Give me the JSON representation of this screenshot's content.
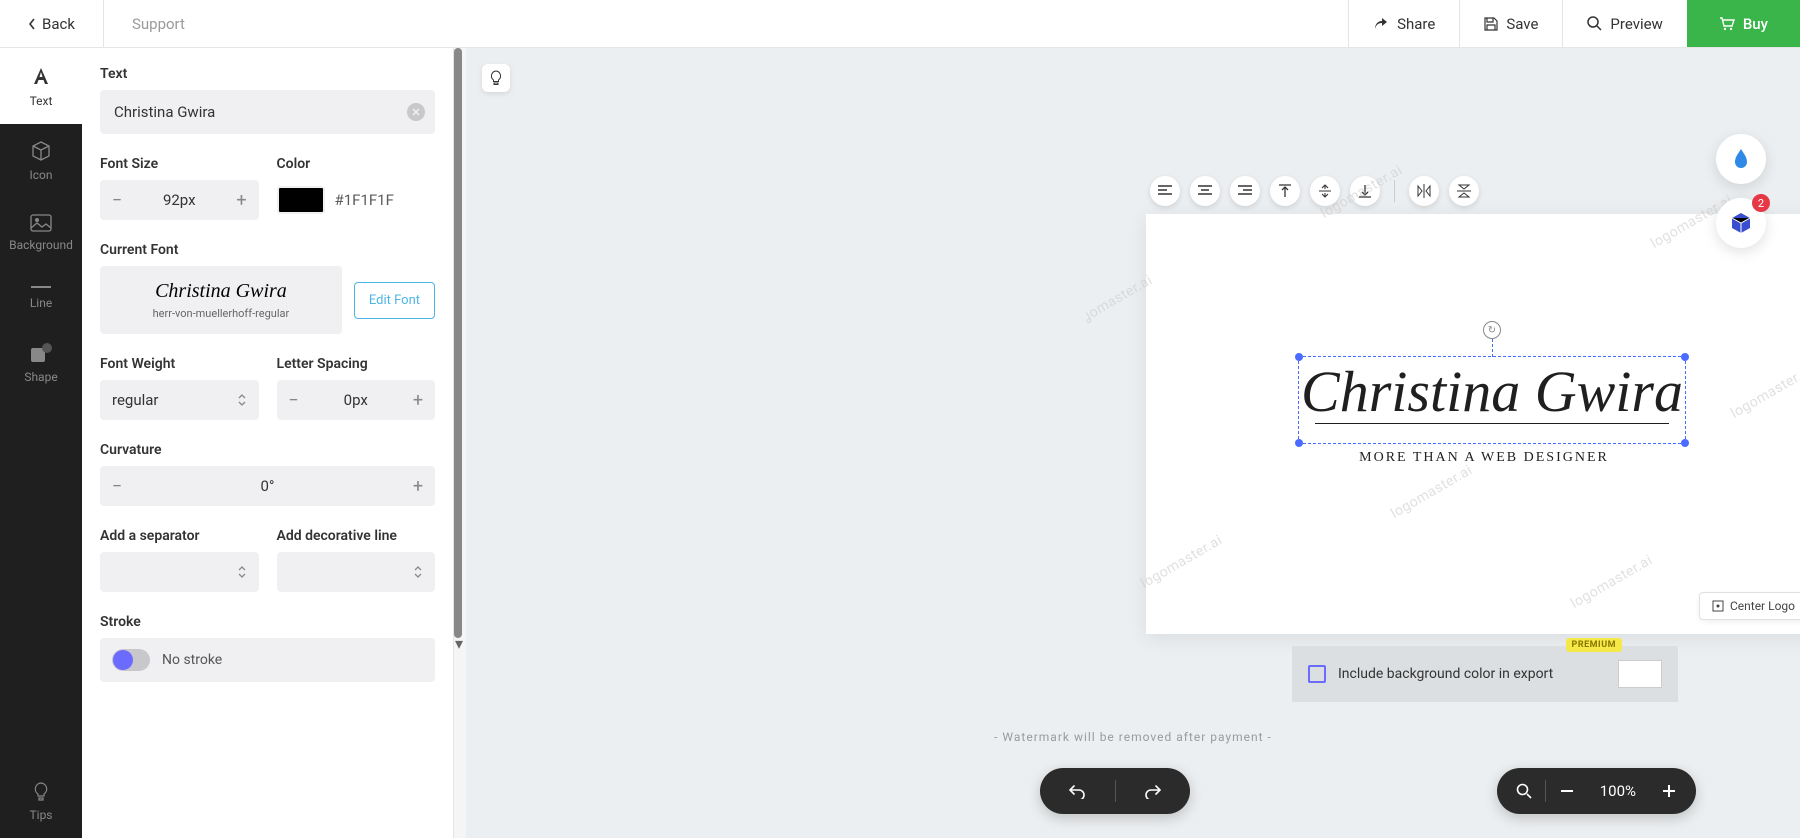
{
  "topbar": {
    "back": "Back",
    "support": "Support",
    "share": "Share",
    "save": "Save",
    "preview": "Preview",
    "buy": "Buy"
  },
  "nav": {
    "text": "Text",
    "icon": "Icon",
    "background": "Background",
    "line": "Line",
    "shape": "Shape",
    "tips": "Tips"
  },
  "panel": {
    "text_label": "Text",
    "text_value": "Christina Gwira",
    "font_size_label": "Font Size",
    "font_size_value": "92px",
    "color_label": "Color",
    "color_hex": "#1F1F1F",
    "current_font_label": "Current Font",
    "font_preview": "Christina Gwira",
    "font_name": "herr-von-muellerhoff-regular",
    "edit_font": "Edit Font",
    "font_weight_label": "Font Weight",
    "font_weight_value": "regular",
    "letter_spacing_label": "Letter Spacing",
    "letter_spacing_value": "0px",
    "curvature_label": "Curvature",
    "curvature_value": "0°",
    "separator_label": "Add a separator",
    "decorative_label": "Add decorative line",
    "stroke_label": "Stroke",
    "no_stroke": "No stroke"
  },
  "canvas": {
    "logo_main": "Christina Gwira",
    "logo_sub": "MORE THAN A WEB DESIGNER",
    "center_logo": "Center Logo",
    "watermark": "logomaster.ai"
  },
  "export": {
    "include_bg": "Include background color in export",
    "premium": "PREMIUM",
    "watermark_note": "- Watermark will be removed after payment -"
  },
  "layers_badge": "2",
  "zoom": "100%"
}
